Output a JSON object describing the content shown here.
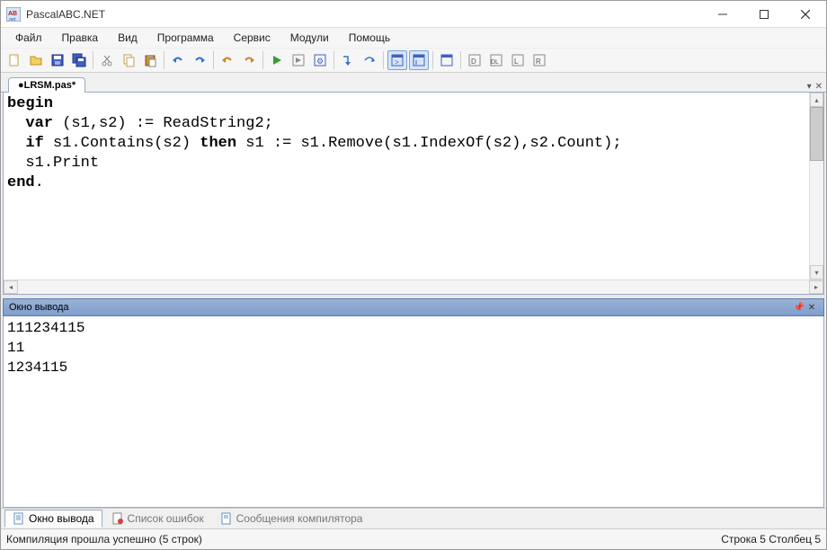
{
  "window": {
    "title": "PascalABC.NET"
  },
  "menu": {
    "file": "Файл",
    "edit": "Правка",
    "view": "Вид",
    "program": "Программа",
    "service": "Сервис",
    "modules": "Модули",
    "help": "Помощь"
  },
  "tab": {
    "name": "●LRSM.pas*"
  },
  "code": {
    "l1a": "begin",
    "l2a": "  ",
    "l2b": "var",
    "l2c": " (s1,s2) := ReadString2;",
    "l3a": "  ",
    "l3b": "if",
    "l3c": " s1.Contains(s2) ",
    "l3d": "then",
    "l3e": " s1 := s1.Remove(s1.IndexOf(s2),s2.Count);",
    "l4a": "  s1.Print",
    "l5a": "end",
    "l5b": "."
  },
  "output": {
    "title": "Окно вывода",
    "line1": "111234115",
    "line2": "11",
    "line3": "1234115"
  },
  "panel_tabs": {
    "output": "Окно вывода",
    "errors": "Список ошибок",
    "compiler": "Сообщения компилятора"
  },
  "status": {
    "left": "Компиляция прошла успешно (5 строк)",
    "right": "Строка  5  Столбец  5"
  }
}
